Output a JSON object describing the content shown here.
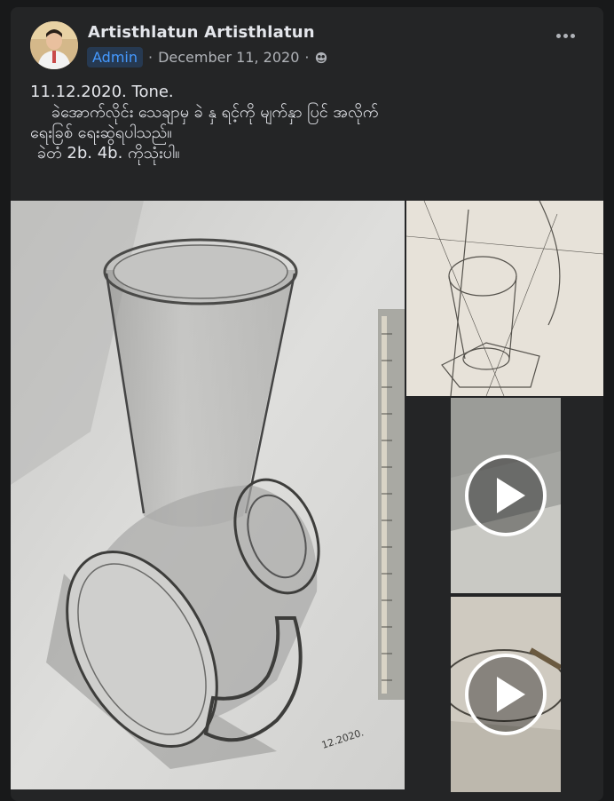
{
  "post": {
    "author": "Artisthlatun Artisthlatun",
    "badge": "Admin",
    "separator1": "·",
    "date": "December 11, 2020",
    "separator2": "·",
    "privacy_icon": "globe-icon",
    "more_icon": "more-options-icon",
    "caption": {
      "line1": "11.12.2020.  Tone.",
      "line2": "ခဲအောက်လိုင်း သေချာမှ ခဲ နှ ရင့်ကို မျက်နှာ ပြင် အလိုက်",
      "line3": "ရေးခြစ် ရေးဆွဲရပါသည်။",
      "line4": "ခဲတံ 2b. 4b. ကိုသုံးပါ။"
    },
    "media": {
      "main_signature": "12.2020.",
      "play_icon": "play-icon"
    }
  },
  "colors": {
    "background": "#18191a",
    "card": "#242526",
    "text_primary": "#e4e6eb",
    "text_secondary": "#b0b3b8",
    "badge_bg": "#263951",
    "badge_text": "#4599ff"
  }
}
